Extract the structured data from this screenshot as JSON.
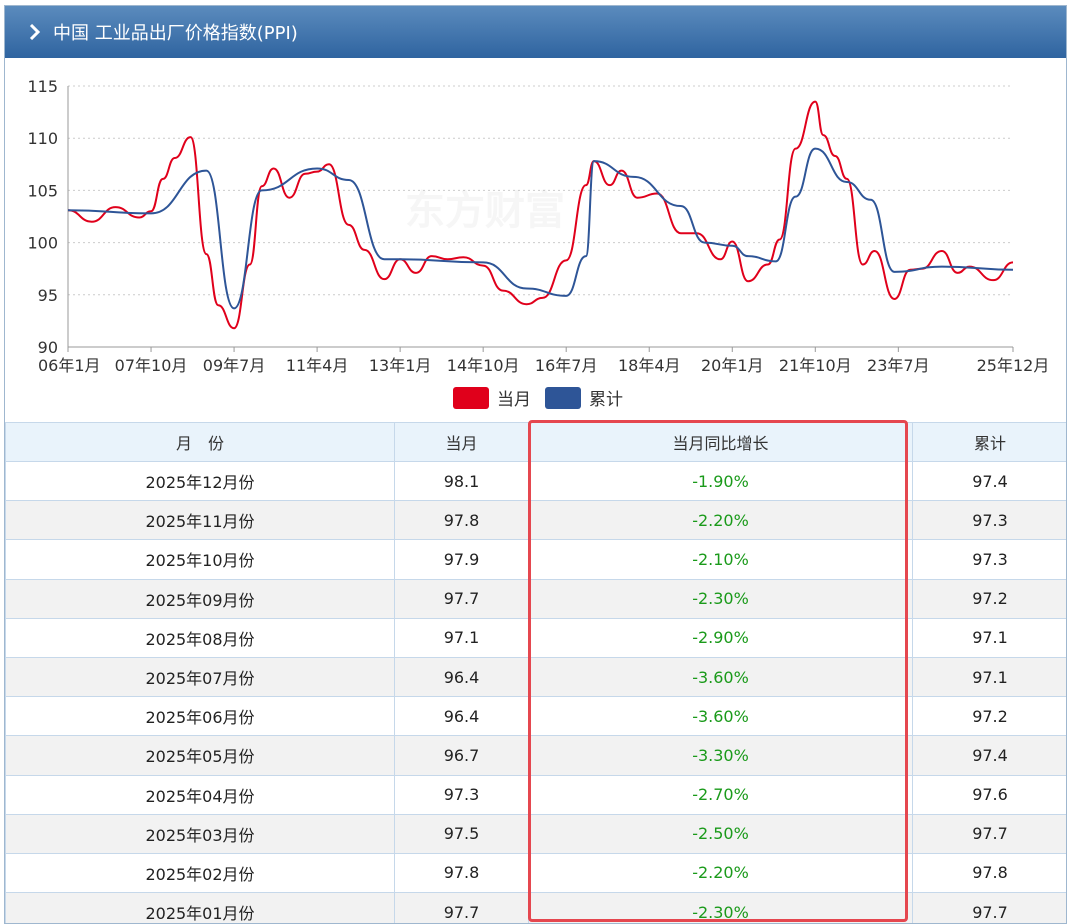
{
  "header": {
    "title": "中国 工业品出厂价格指数(PPI)"
  },
  "watermark": "东方财富",
  "chart_data": {
    "type": "line",
    "xlabel": "",
    "ylabel": "",
    "ylim": [
      90,
      115
    ],
    "yticks": [
      90,
      95,
      100,
      105,
      110,
      115
    ],
    "xticks": [
      "06年1月",
      "07年10月",
      "09年7月",
      "11年4月",
      "13年1月",
      "14年10月",
      "16年7月",
      "18年4月",
      "20年1月",
      "21年10月",
      "23年7月",
      "25年12月"
    ],
    "grid": true,
    "legend_position": "bottom",
    "series": [
      {
        "name": "当月",
        "color": "#e0001b",
        "points": [
          [
            "06年1月",
            103.1
          ],
          [
            "06年7月",
            102.0
          ],
          [
            "07年1月",
            103.4
          ],
          [
            "07年7月",
            102.4
          ],
          [
            "07年10月",
            103.0
          ],
          [
            "08年1月",
            106.1
          ],
          [
            "08年4月",
            108.1
          ],
          [
            "08年8月",
            110.1
          ],
          [
            "08年12月",
            98.9
          ],
          [
            "09年3月",
            94.0
          ],
          [
            "09年7月",
            91.8
          ],
          [
            "09年11月",
            97.9
          ],
          [
            "10年2月",
            105.4
          ],
          [
            "10年5月",
            107.1
          ],
          [
            "10年9月",
            104.3
          ],
          [
            "11年1月",
            106.6
          ],
          [
            "11年4月",
            106.8
          ],
          [
            "11年7月",
            107.5
          ],
          [
            "11年12月",
            101.7
          ],
          [
            "12年4月",
            99.3
          ],
          [
            "12年9月",
            96.5
          ],
          [
            "13年1月",
            98.4
          ],
          [
            "13年5月",
            97.1
          ],
          [
            "13年9月",
            98.7
          ],
          [
            "14年1月",
            98.4
          ],
          [
            "14年5月",
            98.6
          ],
          [
            "14年10月",
            97.8
          ],
          [
            "15年3月",
            95.4
          ],
          [
            "15年9月",
            94.1
          ],
          [
            "16年1月",
            94.7
          ],
          [
            "16年7月",
            98.3
          ],
          [
            "16年12月",
            105.5
          ],
          [
            "17年2月",
            107.8
          ],
          [
            "17年6%",
            105.5
          ],
          [
            "17年9月",
            106.9
          ],
          [
            "18年1月",
            104.3
          ],
          [
            "18年6月",
            104.7
          ],
          [
            "18年12月",
            100.9
          ],
          [
            "19年4月",
            100.9
          ],
          [
            "19年10月",
            98.4
          ],
          [
            "20年1月",
            100.1
          ],
          [
            "20年5月",
            96.3
          ],
          [
            "20年10月",
            97.9
          ],
          [
            "21年1月",
            100.3
          ],
          [
            "21年5月",
            109.0
          ],
          [
            "21年10月",
            113.5
          ],
          [
            "21年12月",
            110.3
          ],
          [
            "22年3月",
            108.3
          ],
          [
            "22年6月",
            106.1
          ],
          [
            "22年10月",
            97.9
          ],
          [
            "23年1月",
            99.2
          ],
          [
            "23年6月",
            94.6
          ],
          [
            "23年10月",
            97.4
          ],
          [
            "24年1月",
            97.5
          ],
          [
            "24年6%",
            99.2
          ],
          [
            "24年10月",
            97.1
          ],
          [
            "25年1月",
            97.7
          ],
          [
            "25年7月",
            96.4
          ],
          [
            "25年12月",
            98.1
          ]
        ]
      },
      {
        "name": "累计",
        "color": "#2e5597",
        "points": [
          [
            "06年1月",
            103.1
          ],
          [
            "07年10月",
            102.8
          ],
          [
            "08年12月",
            106.9
          ],
          [
            "09年7月",
            93.7
          ],
          [
            "10年2月",
            105.0
          ],
          [
            "11年4月",
            107.1
          ],
          [
            "11年12月",
            106.0
          ],
          [
            "12年9月",
            98.4
          ],
          [
            "13年1月",
            98.4
          ],
          [
            "14年10月",
            98.1
          ],
          [
            "15年9月",
            95.6
          ],
          [
            "16年7月",
            94.9
          ],
          [
            "16年12%",
            98.7
          ],
          [
            "17年2月",
            107.8
          ],
          [
            "17年12月",
            106.3
          ],
          [
            "18年12月",
            103.5
          ],
          [
            "19年6月",
            100.0
          ],
          [
            "20年1月",
            99.7
          ],
          [
            "20年5%",
            98.7
          ],
          [
            "20年12月",
            98.2
          ],
          [
            "21年5%",
            104.4
          ],
          [
            "21年10月",
            109.0
          ],
          [
            "22年6%",
            105.8
          ],
          [
            "22年12%",
            104.1
          ],
          [
            "23年6%",
            97.2
          ],
          [
            "24年6%",
            97.7
          ],
          [
            "25年12月",
            97.4
          ]
        ]
      }
    ]
  },
  "table": {
    "headers": [
      "月　份",
      "当月",
      "当月同比增长",
      "累计"
    ],
    "rows": [
      [
        "2025年12月份",
        "98.1",
        "-1.90%",
        "97.4"
      ],
      [
        "2025年11月份",
        "97.8",
        "-2.20%",
        "97.3"
      ],
      [
        "2025年10月份",
        "97.9",
        "-2.10%",
        "97.3"
      ],
      [
        "2025年09月份",
        "97.7",
        "-2.30%",
        "97.2"
      ],
      [
        "2025年08月份",
        "97.1",
        "-2.90%",
        "97.1"
      ],
      [
        "2025年07月份",
        "96.4",
        "-3.60%",
        "97.1"
      ],
      [
        "2025年06月份",
        "96.4",
        "-3.60%",
        "97.2"
      ],
      [
        "2025年05月份",
        "96.7",
        "-3.30%",
        "97.4"
      ],
      [
        "2025年04月份",
        "97.3",
        "-2.70%",
        "97.6"
      ],
      [
        "2025年03月份",
        "97.5",
        "-2.50%",
        "97.7"
      ],
      [
        "2025年02月份",
        "97.8",
        "-2.20%",
        "97.8"
      ],
      [
        "2025年01月份",
        "97.7",
        "-2.30%",
        "97.7"
      ]
    ]
  },
  "colors": {
    "negative": "#1a9a1a",
    "highlight": "#e5474f",
    "header_bg": "#2f64a0"
  }
}
